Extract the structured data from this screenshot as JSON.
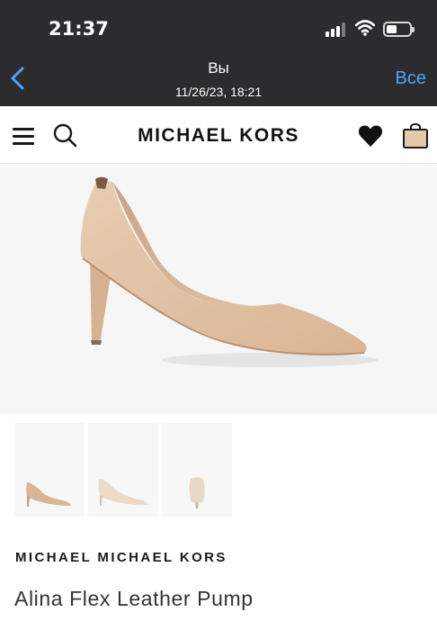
{
  "status_bar": {
    "time": "21:37"
  },
  "viewer": {
    "sender": "Вы",
    "date": "11/26/23, 18:21",
    "all_label": "Все",
    "accent_color": "#4da3ff"
  },
  "store": {
    "brand_logo": "MICHAEL KORS",
    "icons": [
      "menu-icon",
      "search-icon",
      "heart-icon",
      "bag-icon"
    ]
  },
  "product": {
    "brand": "MICHAEL MICHAEL KORS",
    "name": "Alina Flex Leather Pump",
    "thumbnails": [
      "side-view",
      "angled-view",
      "rear-view"
    ],
    "color_swatch": "#e6c9ae"
  }
}
